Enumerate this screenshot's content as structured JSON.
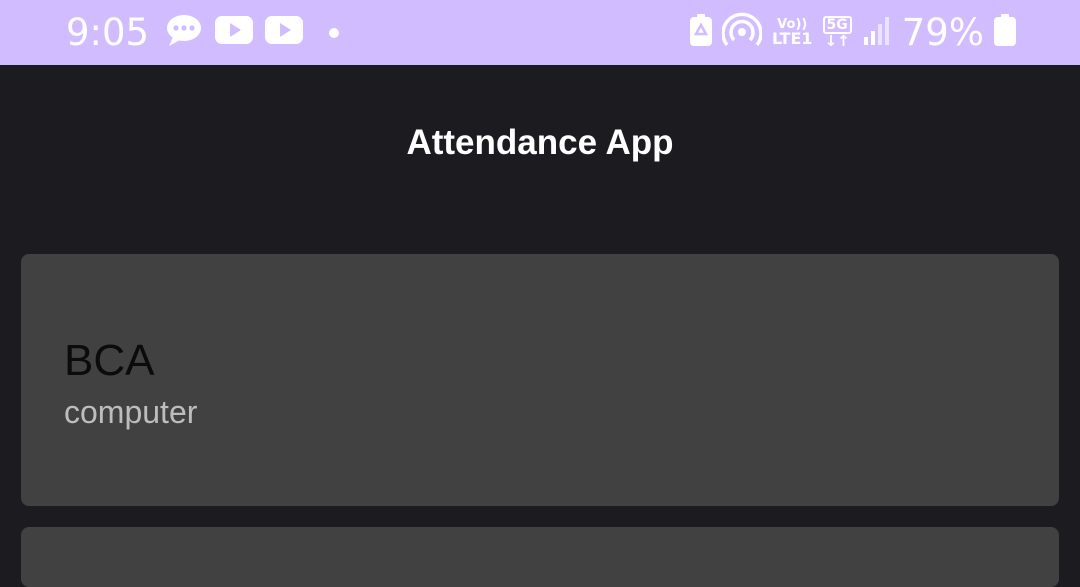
{
  "status_bar": {
    "time": "9:05",
    "network_top": "Vo))",
    "network_bottom": "LTE1",
    "data_type": "5G",
    "battery_percent": "79%",
    "background_color": "#d0bcff",
    "icons": [
      "message-icon",
      "youtube-icon",
      "youtube-icon",
      "notification-dot",
      "battery-saver-icon",
      "hotspot-icon",
      "volte-icon",
      "5g-icon",
      "signal-icon",
      "battery-icon"
    ]
  },
  "app": {
    "title": "Attendance App",
    "background_color": "#1c1b1f"
  },
  "classes": [
    {
      "name": "BCA",
      "subtitle": "computer"
    },
    {
      "name": "",
      "subtitle": ""
    }
  ],
  "card_color": "#414141"
}
